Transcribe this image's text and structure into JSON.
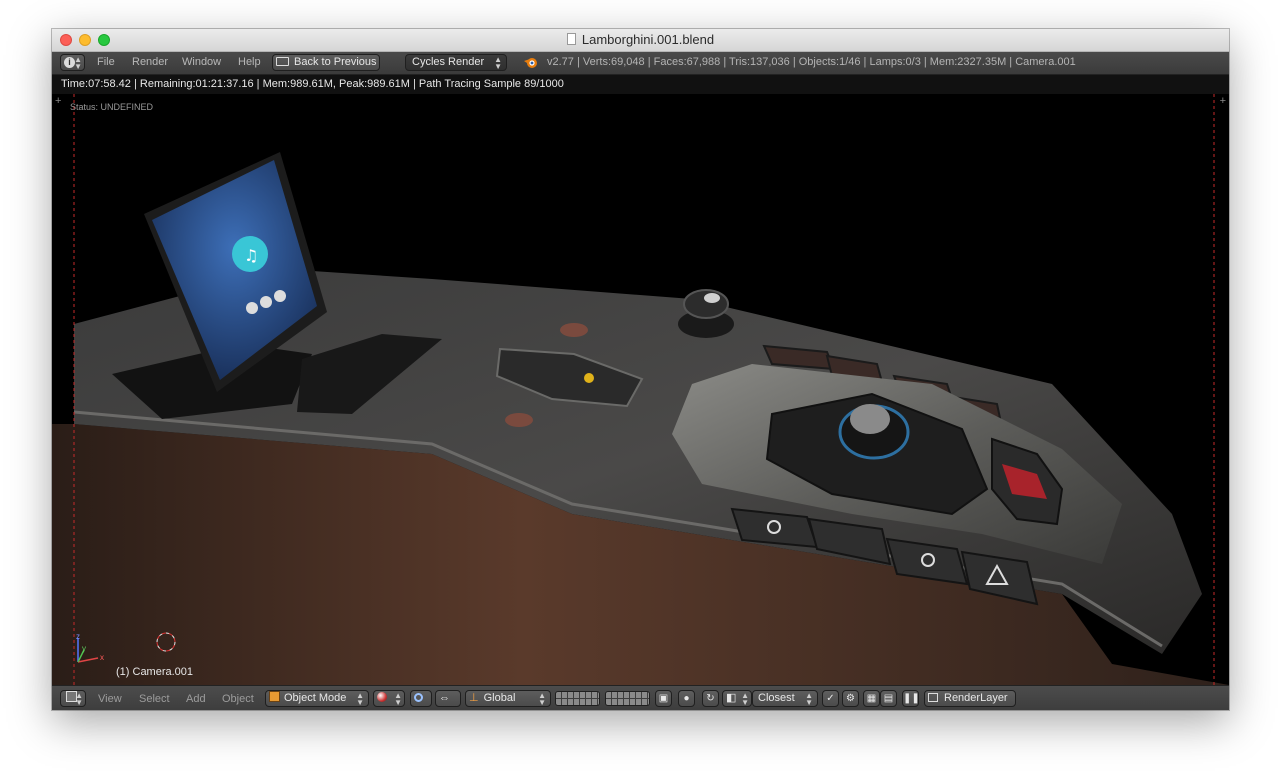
{
  "window": {
    "title": "Lamborghini.001.blend"
  },
  "header": {
    "menu": [
      "File",
      "Render",
      "Window",
      "Help"
    ],
    "back_button": "Back to Previous",
    "render_engine": "Cycles Render",
    "stats": "v2.77 | Verts:69,048 | Faces:67,988 | Tris:137,036 | Objects:1/46 | Lamps:0/3 | Mem:2327.35M | Camera.001"
  },
  "render_status": "Time:07:58.42 | Remaining:01:21:37.16 | Mem:989.61M, Peak:989.61M | Path Tracing Sample 89/1000",
  "viewport": {
    "status_text": "Status: UNDEFINED",
    "camera_label": "(1) Camera.001",
    "axis_labels": {
      "x": "x",
      "y": "y",
      "z": "z"
    }
  },
  "bottom": {
    "menu": [
      "View",
      "Select",
      "Add",
      "Object"
    ],
    "mode": "Object Mode",
    "orientation": "Global",
    "snap_target": "Closest",
    "render_layer": "RenderLayer"
  },
  "colors": {
    "ui_bg": "#434343",
    "render_bg": "#000000",
    "console_dark": "#2b2a29",
    "console_brown": "#3d2a20",
    "screen_blue": "#2a4d8a",
    "accent_cyan": "#39c6d6"
  },
  "icons": [
    "info-icon",
    "blender-logo-icon",
    "view3d-editor-icon",
    "object-mode-cube-icon",
    "shading-sphere-icon",
    "manipulator-icon",
    "layer-grid-icon",
    "snap-magnet-icon",
    "render-layer-icon",
    "pause-icon"
  ]
}
